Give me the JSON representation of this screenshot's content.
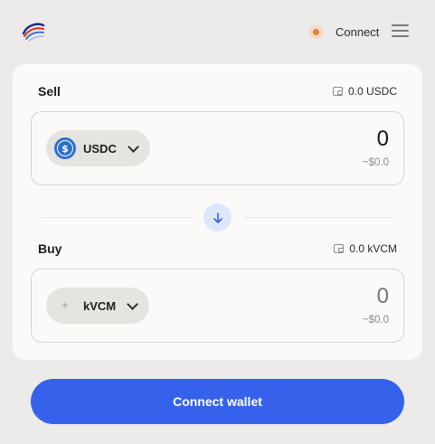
{
  "header": {
    "connect_label": "Connect",
    "status_color": "#d9843b"
  },
  "sell": {
    "label": "Sell",
    "balance": "0.0 USDC",
    "token_symbol": "USDC",
    "token_icon": "usdc-icon",
    "amount": "0",
    "fiat_value": "~$0.0"
  },
  "buy": {
    "label": "Buy",
    "balance": "0.0 kVCM",
    "token_symbol": "kVCM",
    "token_icon": "sparkle-icon",
    "amount_placeholder": "0",
    "fiat_value": "~$0.0"
  },
  "swap_icon": "arrow-down-icon",
  "actions": {
    "connect_wallet_label": "Connect wallet"
  },
  "colors": {
    "accent": "#3561eb",
    "background": "#ecebe9",
    "card": "#fbfaf8"
  }
}
